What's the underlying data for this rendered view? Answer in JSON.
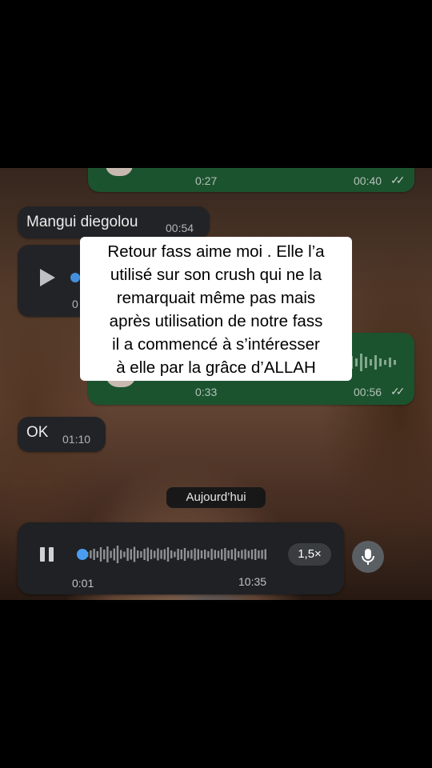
{
  "messages": {
    "out_top": {
      "duration": "0:27",
      "time": "00:40"
    },
    "in_text": {
      "text": "Mangui diegolou",
      "time": "00:54"
    },
    "in_voice": {
      "duration": "0"
    },
    "out_voice": {
      "duration": "0:33",
      "time": "00:56"
    },
    "in_ok": {
      "text": "OK",
      "time": "01:10"
    }
  },
  "overlay": {
    "lines": [
      "Retour fass aime moi . Elle l’a",
      "utilisé sur son crush qui ne la",
      "remarquait même pas mais",
      "après utilisation de notre fass",
      "il a commencé à s’intéresser",
      "à elle par la grâce d’ALLAH"
    ]
  },
  "date_chip": "Aujourd’hui",
  "player": {
    "elapsed": "0:01",
    "total": "10:35",
    "speed": "1,5×",
    "progress": 0.0
  },
  "icons": {
    "play": "play-icon",
    "pause": "pause-icon",
    "mic": "microphone-icon",
    "read_receipt": "double-check-icon"
  },
  "colors": {
    "outgoing_bubble": "#1f5b34",
    "incoming_bubble": "#25272a",
    "playhead": "#4a9cf0"
  }
}
